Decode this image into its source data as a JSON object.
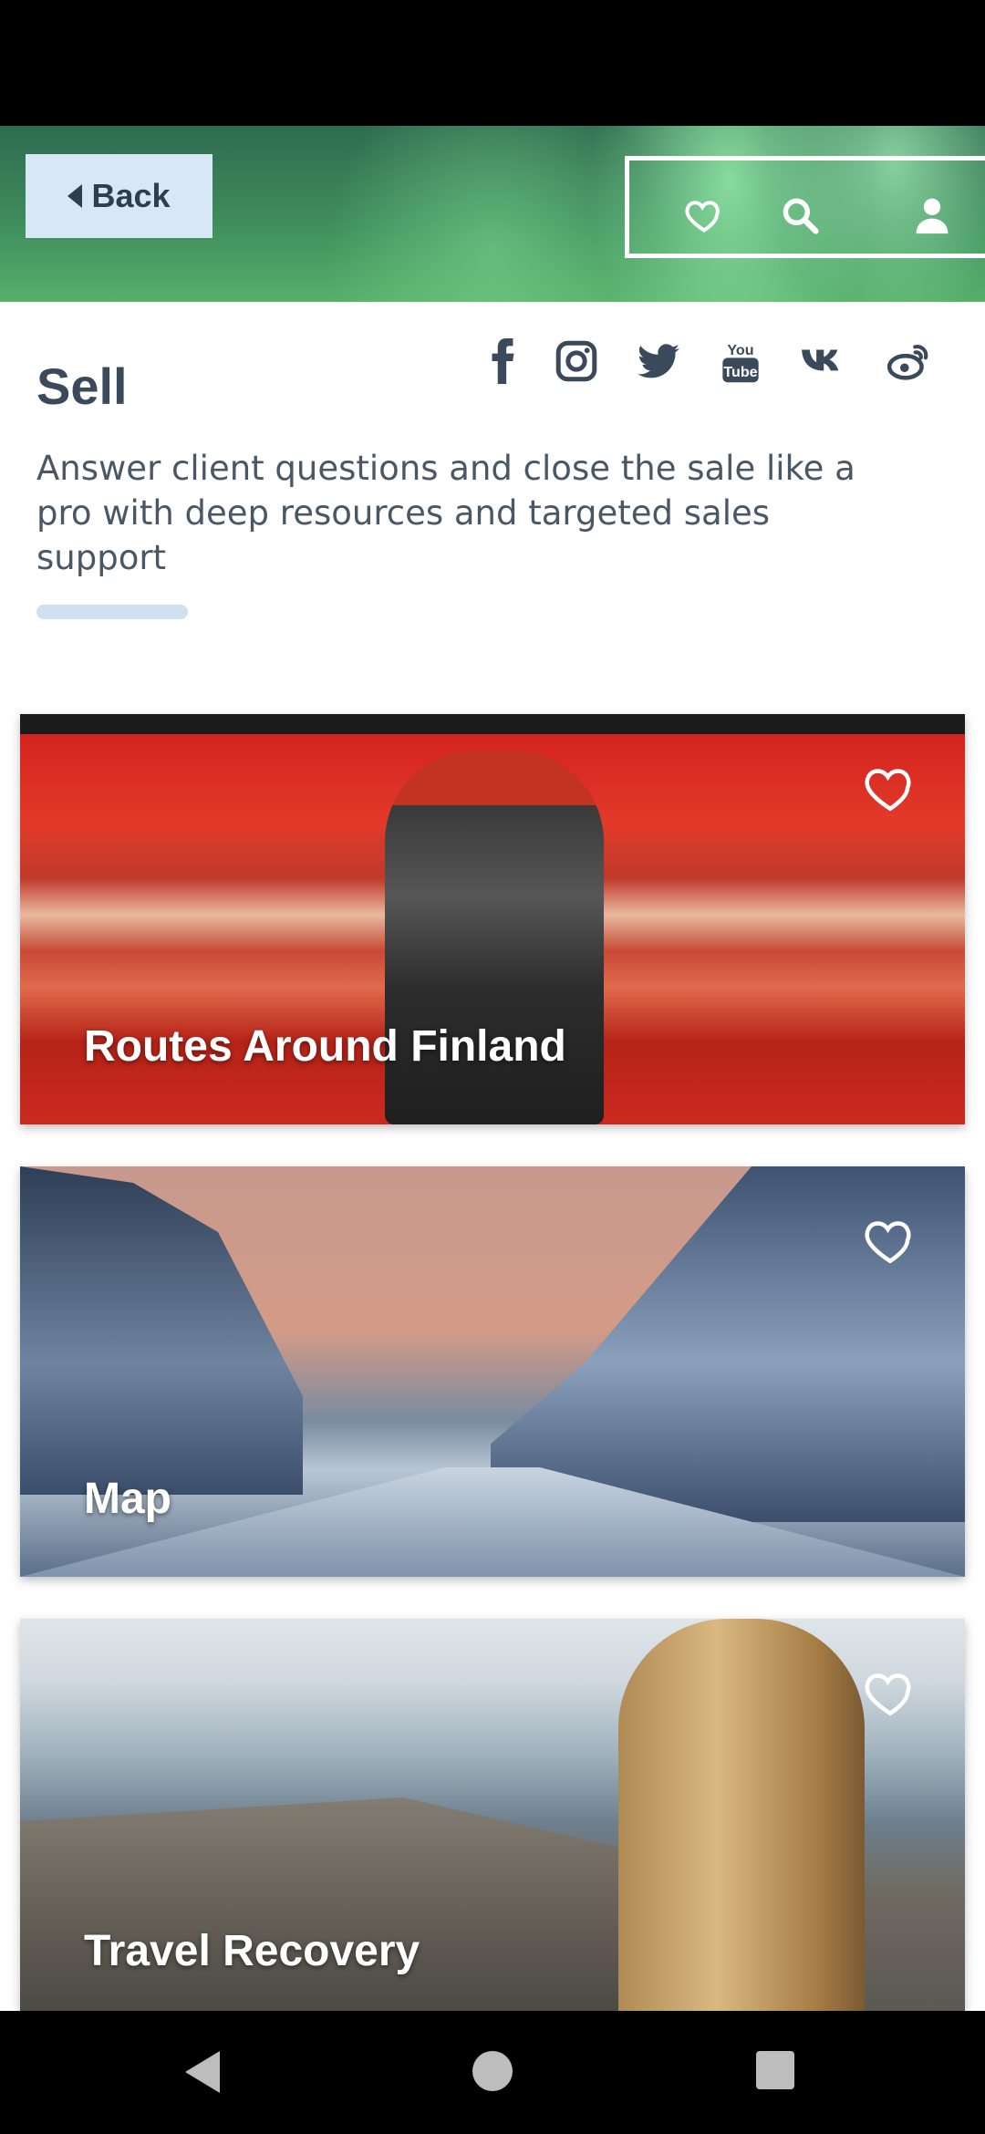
{
  "header": {
    "back_label": "Back",
    "icons": [
      "heart-icon",
      "search-icon",
      "user-icon"
    ]
  },
  "intro": {
    "title": "Sell",
    "description": "Answer client questions and close the sale like a pro with deep resources and targeted sales support",
    "social_icons": [
      "facebook-icon",
      "instagram-icon",
      "twitter-icon",
      "youtube-icon",
      "vk-icon",
      "weibo-icon"
    ]
  },
  "cards": [
    {
      "title": "Routes Around Finland",
      "favorite": false
    },
    {
      "title": "Map",
      "favorite": false
    },
    {
      "title": "Travel Recovery",
      "favorite": false
    }
  ],
  "colors": {
    "accent_bar": "#cfe0f1",
    "back_button_bg": "#d8e7f5",
    "title_text": "#3a4a5a"
  }
}
